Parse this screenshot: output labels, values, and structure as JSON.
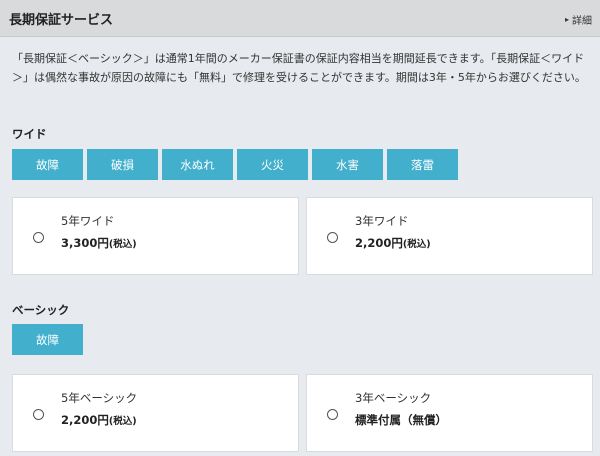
{
  "header": {
    "title": "長期保証サービス",
    "detail_link": "詳細"
  },
  "description": "「長期保証＜ベーシック＞」は通常1年間のメーカー保証書の保証内容相当を期間延長できます。「長期保証＜ワイド＞」は偶然な事故が原因の故障にも「無料」で修理を受けることができます。期間は3年・5年からお選びください。",
  "wide": {
    "title": "ワイド",
    "tags": [
      "故障",
      "破損",
      "水ぬれ",
      "火災",
      "水害",
      "落雷"
    ],
    "options": [
      {
        "name": "5年ワイド",
        "price": "3,300円",
        "tax": "(税込)"
      },
      {
        "name": "3年ワイド",
        "price": "2,200円",
        "tax": "(税込)"
      }
    ]
  },
  "basic": {
    "title": "ベーシック",
    "tags": [
      "故障"
    ],
    "options": [
      {
        "name": "5年ベーシック",
        "price": "2,200円",
        "tax": "(税込)"
      },
      {
        "name": "3年ベーシック",
        "price": "標準付属（無償）",
        "tax": ""
      }
    ]
  }
}
